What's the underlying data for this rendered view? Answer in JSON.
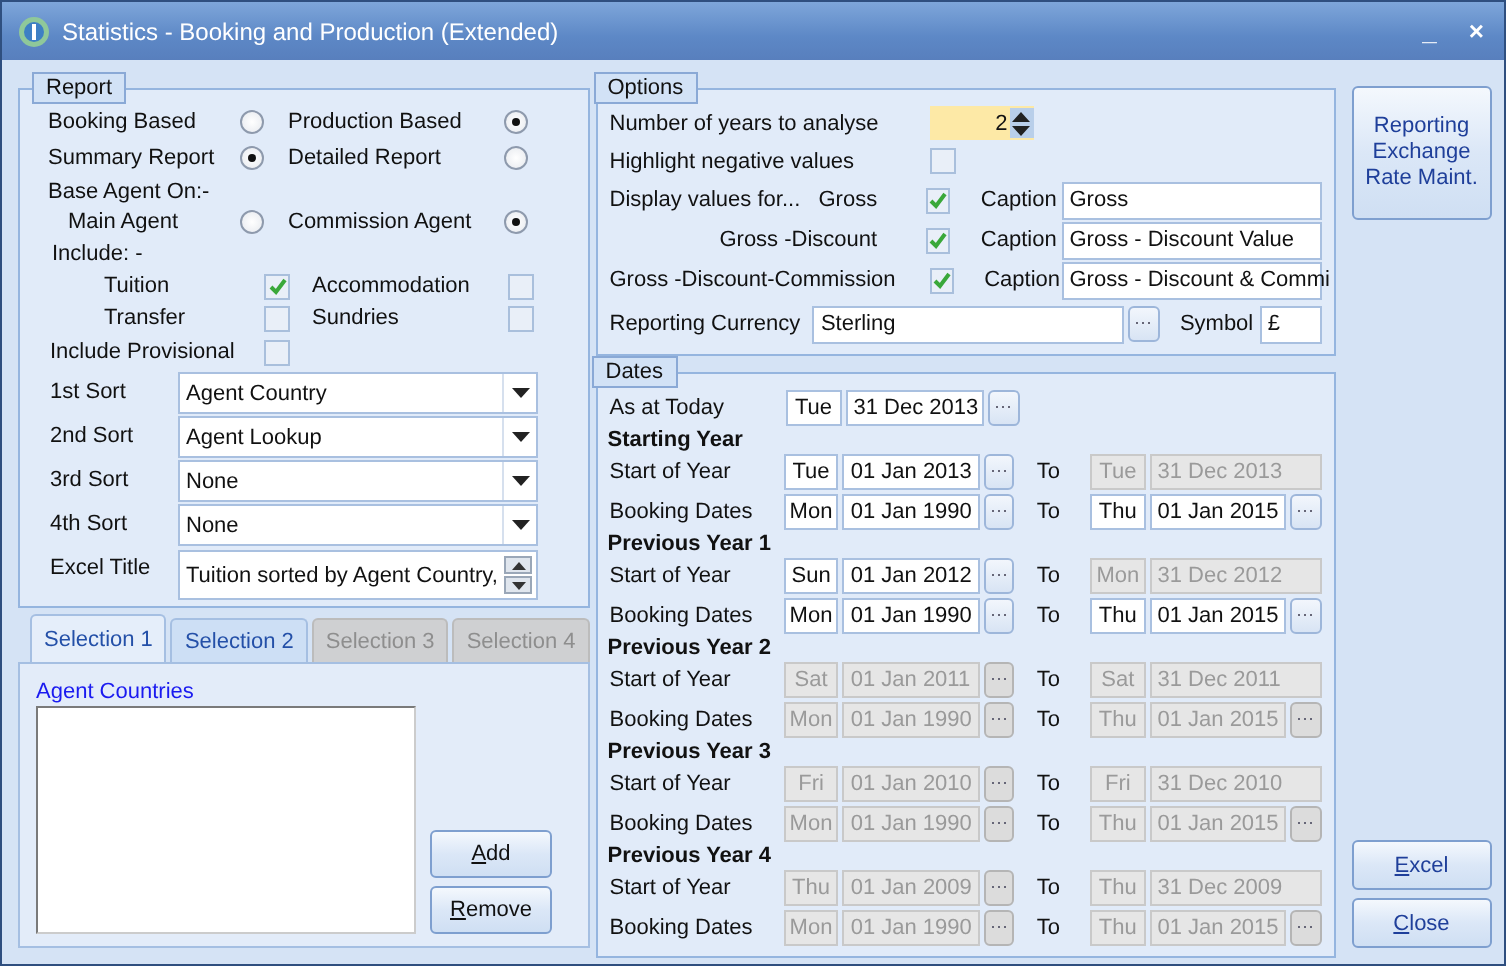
{
  "window": {
    "title": "Statistics - Booking and Production (Extended)",
    "controls": [
      "_",
      "×"
    ]
  },
  "report": {
    "title": "Report",
    "basis": [
      {
        "label": "Booking Based",
        "selected": false
      },
      {
        "label": "Production Based",
        "selected": true
      }
    ],
    "layout": [
      {
        "label": "Summary Report",
        "selected": true
      },
      {
        "label": "Detailed Report",
        "selected": false
      }
    ],
    "base_agent_label": "Base Agent On:-",
    "base_agent": [
      {
        "label": "Main Agent",
        "selected": false
      },
      {
        "label": "Commission Agent",
        "selected": true
      }
    ],
    "include_label": "Include: -",
    "include": [
      {
        "label": "Tuition",
        "checked": true
      },
      {
        "label": "Accommodation",
        "checked": false
      },
      {
        "label": "Transfer",
        "checked": false
      },
      {
        "label": "Sundries",
        "checked": false
      }
    ],
    "provisional": {
      "label": "Include Provisional",
      "checked": false
    },
    "sorts": [
      {
        "label": "1st Sort",
        "value": "Agent Country"
      },
      {
        "label": "2nd Sort",
        "value": "Agent Lookup"
      },
      {
        "label": "3rd Sort",
        "value": "None"
      },
      {
        "label": "4th Sort",
        "value": "None"
      }
    ],
    "excel_title": {
      "label": "Excel Title",
      "value": "Tuition sorted by Agent Country,"
    }
  },
  "tabs": [
    {
      "label": "Selection 1",
      "selected": true,
      "disabled": false
    },
    {
      "label": "Selection 2",
      "selected": false,
      "disabled": false
    },
    {
      "label": "Selection 3",
      "selected": false,
      "disabled": true
    },
    {
      "label": "Selection 4",
      "selected": false,
      "disabled": true
    }
  ],
  "selection": {
    "list_label": "Agent Countries",
    "buttons": [
      "Add",
      "Remove"
    ]
  },
  "options": {
    "title": "Options",
    "years": {
      "label": "Number of years to analyse",
      "value": "2"
    },
    "highlight": {
      "label": "Highlight negative values",
      "checked": false
    },
    "display_label": "Display values for...",
    "values": [
      {
        "label": "Gross",
        "checked": true,
        "caption_label": "Caption",
        "caption": "Gross"
      },
      {
        "label": "Gross -Discount",
        "checked": true,
        "caption_label": "Caption",
        "caption": "Gross - Discount Value"
      },
      {
        "label": "Gross  -Discount-Commission",
        "checked": true,
        "caption_label": "Caption",
        "caption": "Gross - Discount & Commi"
      }
    ],
    "currency": {
      "label": "Reporting Currency",
      "value": "Sterling",
      "symbol_label": "Symbol",
      "symbol": "£"
    }
  },
  "dates": {
    "title": "Dates",
    "today": {
      "label": "As at Today",
      "day": "Tue",
      "date": "31 Dec 2013",
      "disabled": false,
      "picker": true
    },
    "years": [
      {
        "heading": "Starting Year",
        "rows": [
          {
            "label": "Start of Year",
            "to_label": "To",
            "from": {
              "day": "Tue",
              "date": "01 Jan 2013",
              "disabled": false,
              "picker": true
            },
            "to": {
              "day": "Tue",
              "date": "31 Dec 2013",
              "disabled": true,
              "picker": false
            }
          },
          {
            "label": "Booking Dates",
            "to_label": "To",
            "from": {
              "day": "Mon",
              "date": "01 Jan 1990",
              "disabled": false,
              "picker": true
            },
            "to": {
              "day": "Thu",
              "date": "01 Jan 2015",
              "disabled": false,
              "picker": true
            }
          }
        ]
      },
      {
        "heading": "Previous Year 1",
        "rows": [
          {
            "label": "Start of Year",
            "to_label": "To",
            "from": {
              "day": "Sun",
              "date": "01 Jan 2012",
              "disabled": false,
              "picker": true
            },
            "to": {
              "day": "Mon",
              "date": "31 Dec 2012",
              "disabled": true,
              "picker": false
            }
          },
          {
            "label": "Booking Dates",
            "to_label": "To",
            "from": {
              "day": "Mon",
              "date": "01 Jan 1990",
              "disabled": false,
              "picker": true
            },
            "to": {
              "day": "Thu",
              "date": "01 Jan 2015",
              "disabled": false,
              "picker": true
            }
          }
        ]
      },
      {
        "heading": "Previous Year 2",
        "rows": [
          {
            "label": "Start of Year",
            "to_label": "To",
            "from": {
              "day": "Sat",
              "date": "01 Jan 2011",
              "disabled": true,
              "picker": true
            },
            "to": {
              "day": "Sat",
              "date": "31 Dec 2011",
              "disabled": true,
              "picker": false
            }
          },
          {
            "label": "Booking Dates",
            "to_label": "To",
            "from": {
              "day": "Mon",
              "date": "01 Jan 1990",
              "disabled": true,
              "picker": true
            },
            "to": {
              "day": "Thu",
              "date": "01 Jan 2015",
              "disabled": true,
              "picker": true
            }
          }
        ]
      },
      {
        "heading": "Previous Year 3",
        "rows": [
          {
            "label": "Start of Year",
            "to_label": "To",
            "from": {
              "day": "Fri",
              "date": "01 Jan 2010",
              "disabled": true,
              "picker": true
            },
            "to": {
              "day": "Fri",
              "date": "31 Dec 2010",
              "disabled": true,
              "picker": false
            }
          },
          {
            "label": "Booking Dates",
            "to_label": "To",
            "from": {
              "day": "Mon",
              "date": "01 Jan 1990",
              "disabled": true,
              "picker": true
            },
            "to": {
              "day": "Thu",
              "date": "01 Jan 2015",
              "disabled": true,
              "picker": true
            }
          }
        ]
      },
      {
        "heading": "Previous Year 4",
        "rows": [
          {
            "label": "Start of Year",
            "to_label": "To",
            "from": {
              "day": "Thu",
              "date": "01 Jan 2009",
              "disabled": true,
              "picker": true
            },
            "to": {
              "day": "Thu",
              "date": "31 Dec 2009",
              "disabled": true,
              "picker": false
            }
          },
          {
            "label": "Booking Dates",
            "to_label": "To",
            "from": {
              "day": "Mon",
              "date": "01 Jan 1990",
              "disabled": true,
              "picker": true
            },
            "to": {
              "day": "Thu",
              "date": "01 Jan 2015",
              "disabled": true,
              "picker": true
            }
          }
        ]
      }
    ]
  },
  "side": {
    "rate_button": "Reporting Exchange Rate Maint.",
    "actions": [
      "Excel",
      "Close"
    ]
  }
}
